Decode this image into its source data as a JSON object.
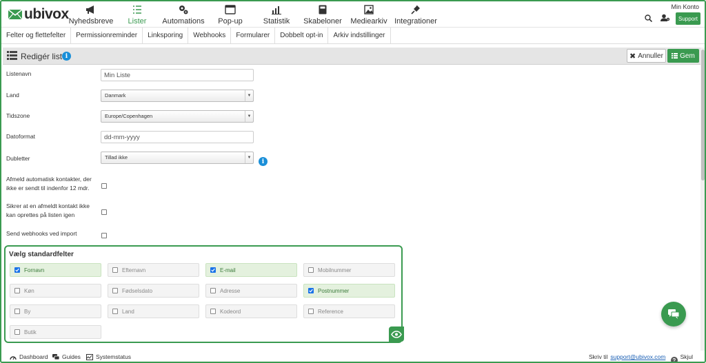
{
  "brand": {
    "name": "ubivox",
    "color": "#3a9a50"
  },
  "nav": {
    "items": [
      {
        "label": "Nyhedsbreve",
        "icon": "megaphone-icon",
        "active": false
      },
      {
        "label": "Lister",
        "icon": "list-icon",
        "active": true
      },
      {
        "label": "Automations",
        "icon": "gears-icon",
        "active": false
      },
      {
        "label": "Pop-up",
        "icon": "popup-icon",
        "active": false
      },
      {
        "label": "Statistik",
        "icon": "chart-icon",
        "active": false
      },
      {
        "label": "Skabeloner",
        "icon": "template-icon",
        "active": false
      },
      {
        "label": "Mediearkiv",
        "icon": "image-icon",
        "active": false
      },
      {
        "label": "Integrationer",
        "icon": "plug-icon",
        "active": false
      }
    ],
    "account": "Min Konto",
    "support": "Support"
  },
  "subnav": [
    "Felter og flettefelter",
    "Permissionreminder",
    "Linksporing",
    "Webhooks",
    "Formularer",
    "Dobbelt opt-in",
    "Arkiv indstillinger"
  ],
  "editbar": {
    "title": "Redigér liste",
    "cancel": "Annuller",
    "save": "Gem"
  },
  "form": {
    "listname_label": "Listenavn",
    "listname_value": "Min Liste",
    "country_label": "Land",
    "country_value": "Danmark",
    "timezone_label": "Tidszone",
    "timezone_value": "Europe/Copenhagen",
    "dateformat_label": "Datoformat",
    "dateformat_value": "dd-mm-yyyy",
    "duplicates_label": "Dubletter",
    "duplicates_value": "Tillad ikke",
    "auto_unsub_label": "Afmeld automatisk kontakter, der ikke er sendt til indenfor 12 mdr.",
    "ensure_unsub_label": "Sikrer at en afmeldt kontakt ikke kan oprettes på listen igen",
    "webhooks_label": "Send webhooks ved import"
  },
  "standard_fields": {
    "title": "Vælg standardfelter",
    "fields": [
      {
        "label": "Fornavn",
        "checked": true
      },
      {
        "label": "Efternavn",
        "checked": false
      },
      {
        "label": "E-mail",
        "checked": true
      },
      {
        "label": "Mobilnummer",
        "checked": false
      },
      {
        "label": "Køn",
        "checked": false
      },
      {
        "label": "Fødselsdato",
        "checked": false
      },
      {
        "label": "Adresse",
        "checked": false
      },
      {
        "label": "Postnummer",
        "checked": true
      },
      {
        "label": "By",
        "checked": false
      },
      {
        "label": "Land",
        "checked": false
      },
      {
        "label": "Kodeord",
        "checked": false
      },
      {
        "label": "Reference",
        "checked": false
      },
      {
        "label": "Butik",
        "checked": false
      }
    ]
  },
  "footer": {
    "dashboard": "Dashboard",
    "guides": "Guides",
    "status": "Systemstatus",
    "write_to": "Skriv til",
    "email": "support@ubivox.com",
    "hide_chat": "Skjul chat"
  }
}
